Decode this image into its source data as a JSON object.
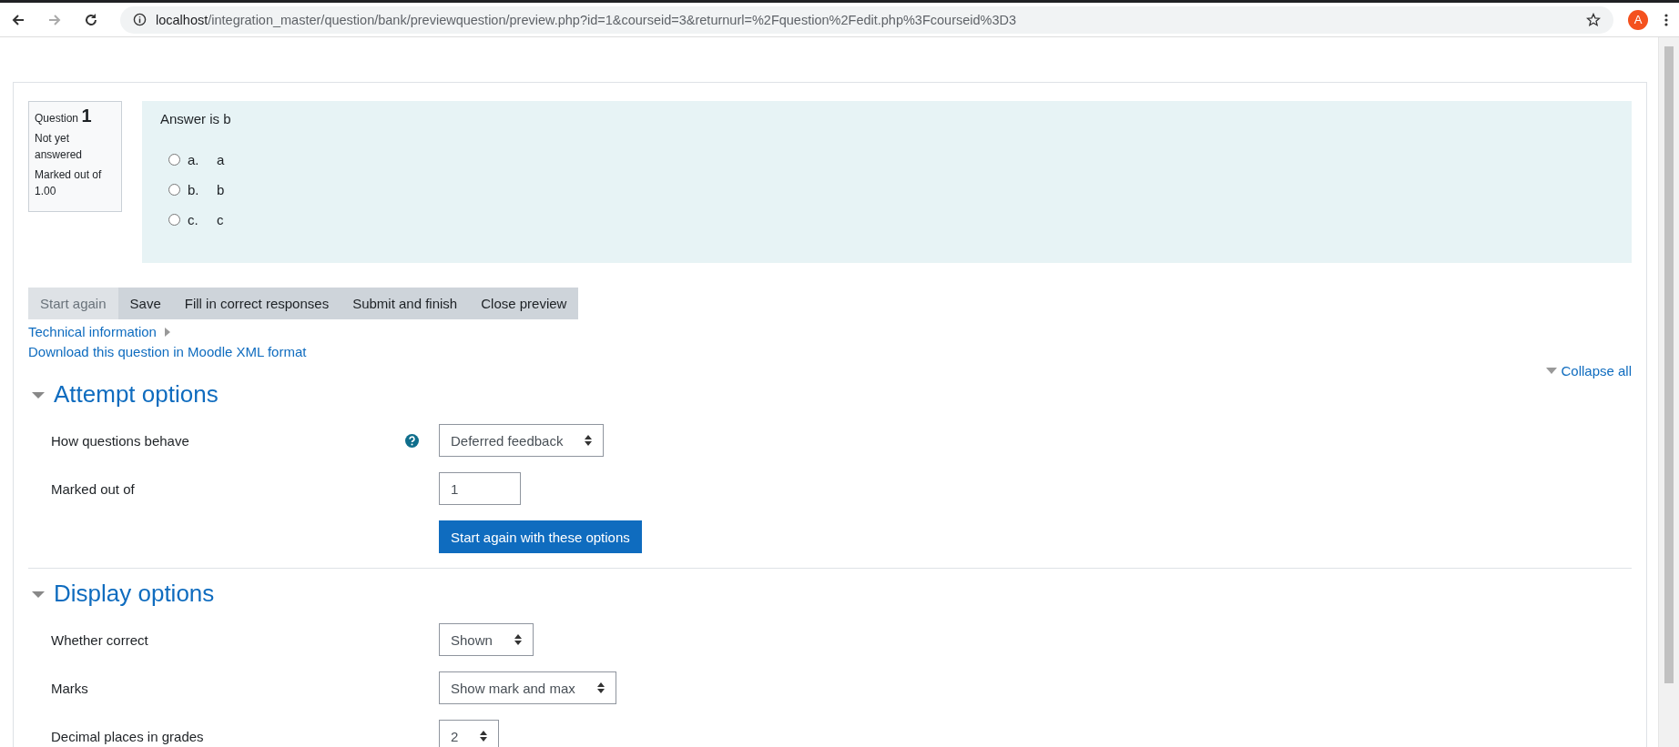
{
  "browser": {
    "url_host": "localhost",
    "url_path": "/integration_master/question/bank/previewquestion/preview.php?id=1&courseid=3&returnurl=%2Fquestion%2Fedit.php%3Fcourseid%3D3",
    "avatar_letter": "A"
  },
  "question": {
    "label": "Question",
    "number": "1",
    "state": "Not yet answered",
    "marks": "Marked out of 1.00",
    "text": "Answer is b",
    "options": [
      {
        "letter": "a.",
        "text": "a",
        "selected": false
      },
      {
        "letter": "b.",
        "text": "b",
        "selected": false
      },
      {
        "letter": "c.",
        "text": "c",
        "selected": false
      }
    ]
  },
  "buttons": [
    {
      "label": "Start again",
      "disabled": true
    },
    {
      "label": "Save",
      "disabled": false
    },
    {
      "label": "Fill in correct responses",
      "disabled": false
    },
    {
      "label": "Submit and finish",
      "disabled": false
    },
    {
      "label": "Close preview",
      "disabled": false
    }
  ],
  "technical_information": {
    "label": "Technical information",
    "expanded": false
  },
  "download_link": "Download this question in Moodle XML format",
  "collapse_all": "Collapse all",
  "sections": [
    {
      "title": "Attempt options",
      "expanded": true,
      "rows": [
        {
          "kind": "select",
          "label": "How questions behave",
          "value": "Deferred feedback",
          "help": true
        },
        {
          "kind": "text",
          "label": "Marked out of",
          "value": "1",
          "help": false
        },
        {
          "kind": "button",
          "label": "Start again with these options",
          "help": false
        }
      ]
    },
    {
      "title": "Display options",
      "expanded": true,
      "rows": [
        {
          "kind": "select",
          "label": "Whether correct",
          "value": "Shown",
          "help": false
        },
        {
          "kind": "select",
          "label": "Marks",
          "value": "Show mark and max",
          "help": false
        },
        {
          "kind": "select",
          "label": "Decimal places in grades",
          "value": "2",
          "help": false
        }
      ]
    }
  ]
}
